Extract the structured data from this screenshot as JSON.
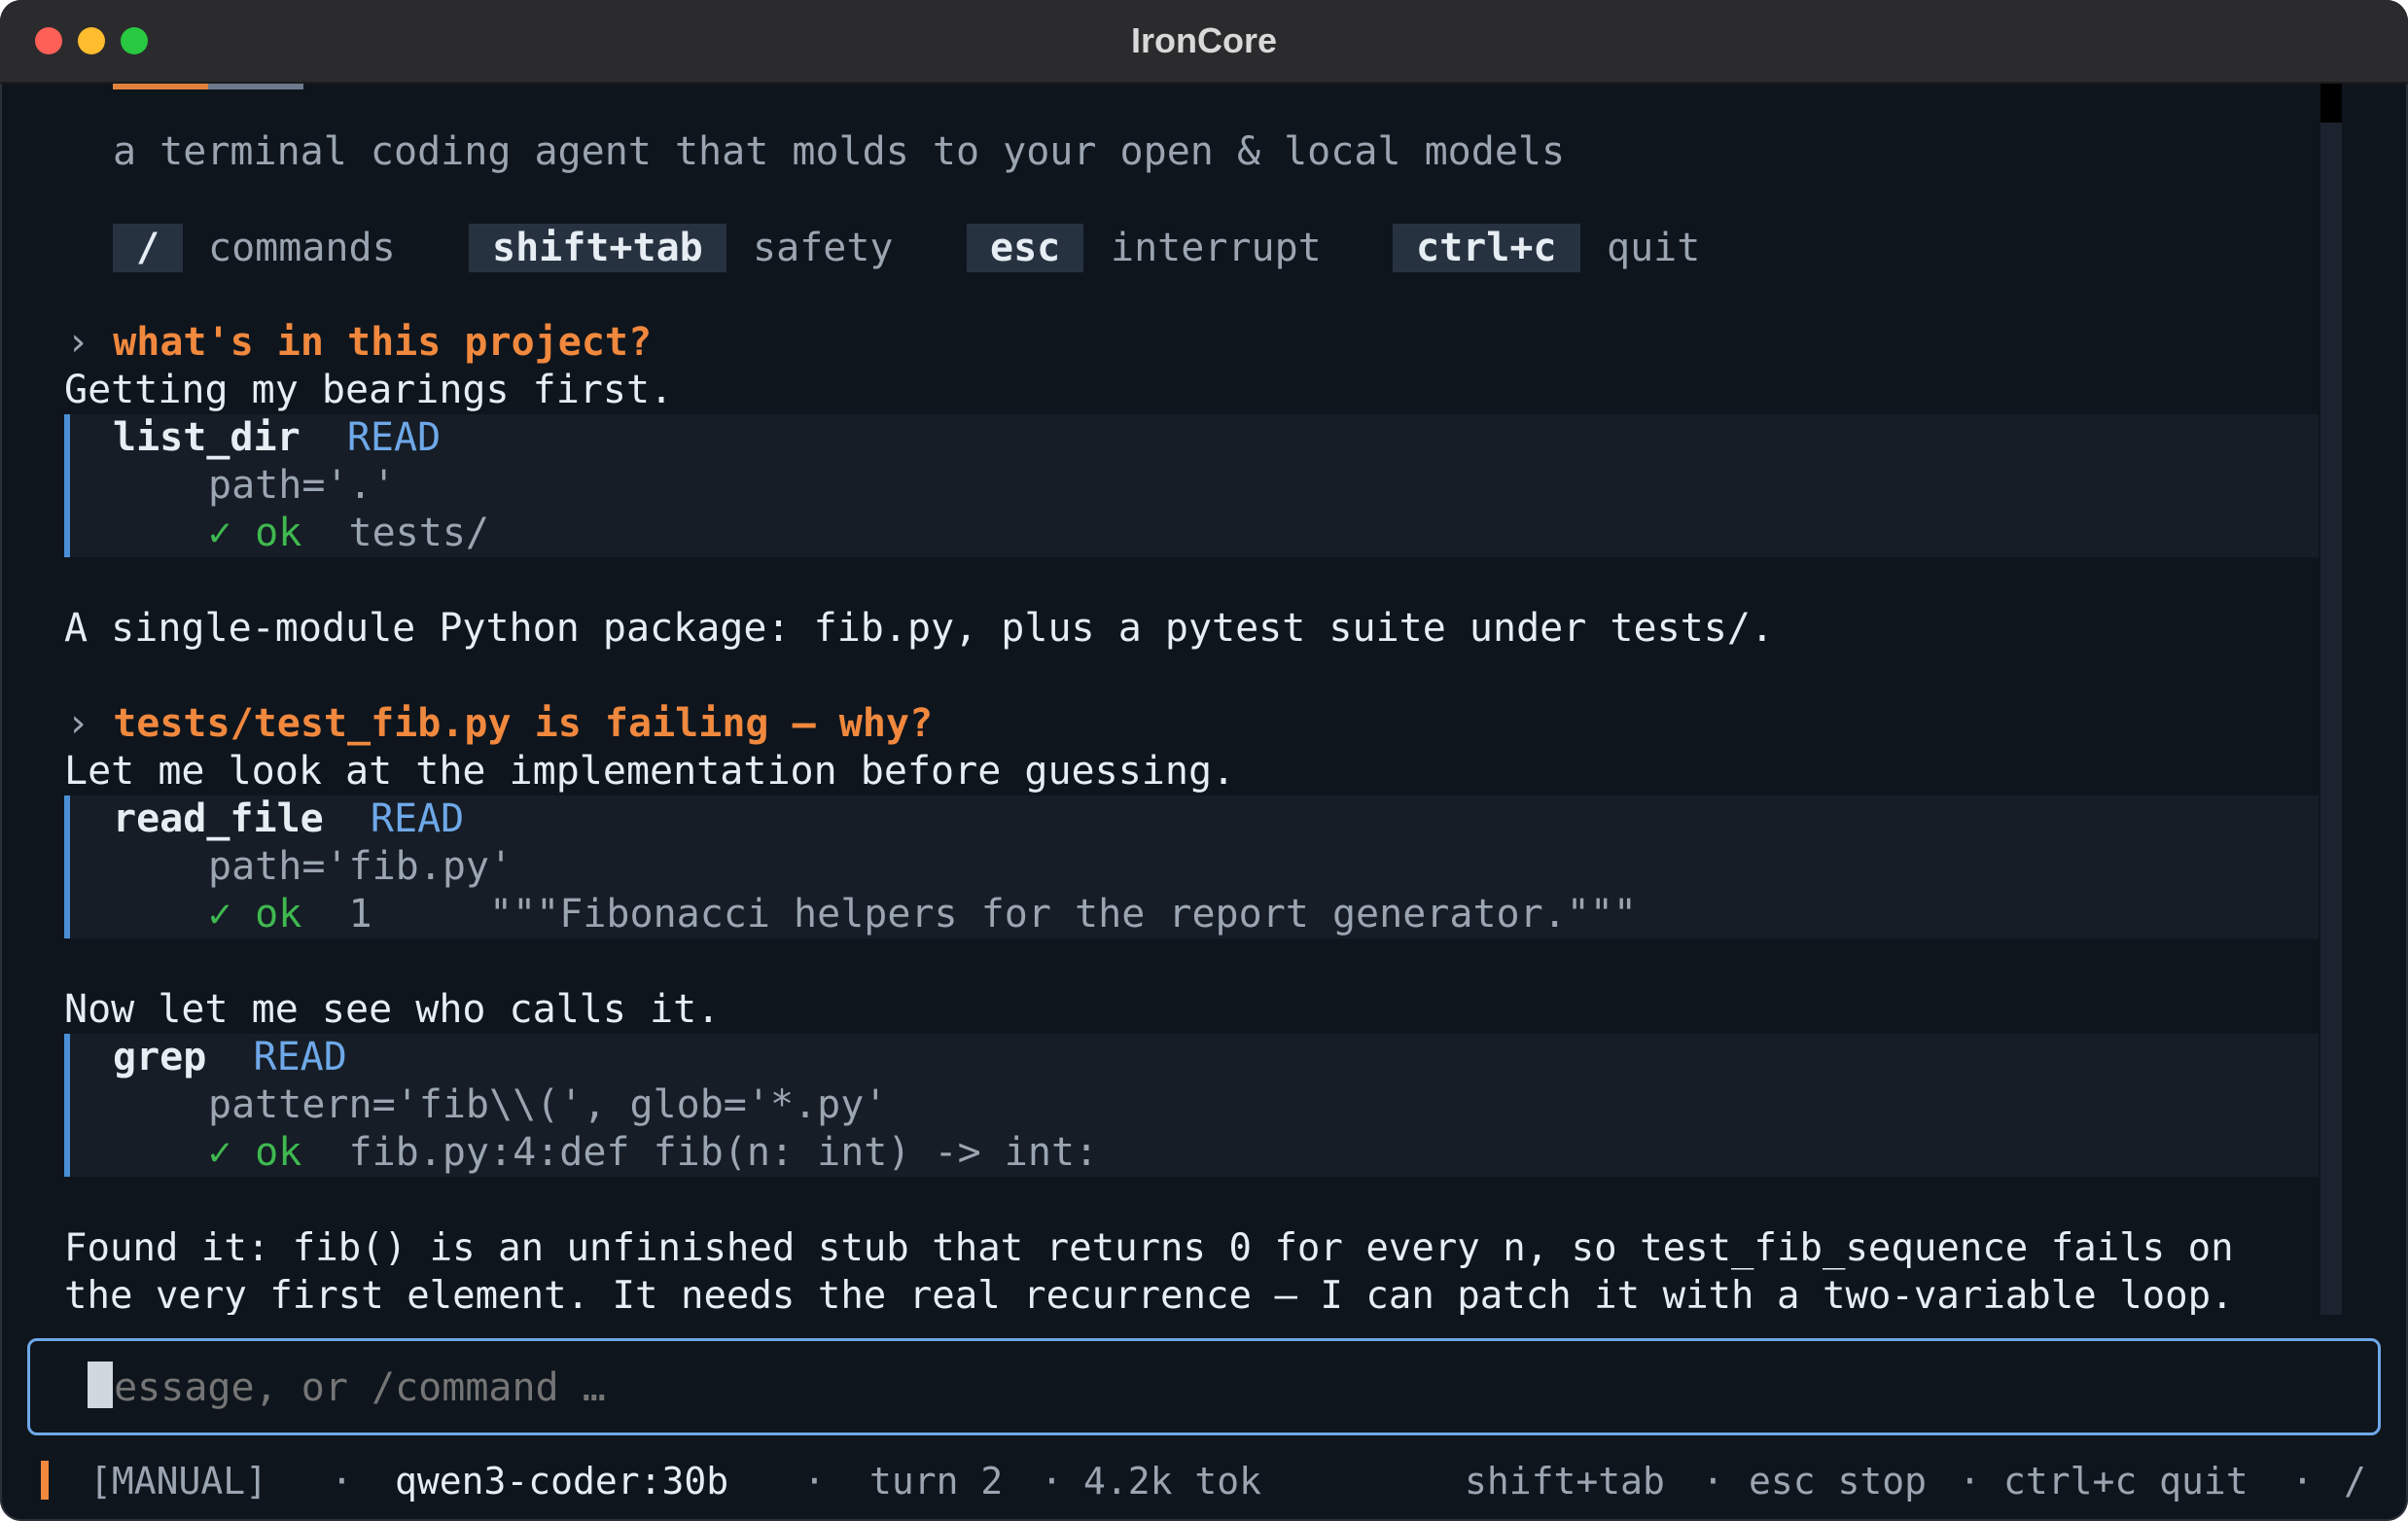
{
  "window": {
    "title": "IronCore"
  },
  "intro": {
    "tagline": "a terminal coding agent that molds to your open & local models",
    "keys": [
      {
        "key": "/",
        "label": "commands"
      },
      {
        "key": "shift+tab",
        "label": "safety"
      },
      {
        "key": "esc",
        "label": "interrupt"
      },
      {
        "key": "ctrl+c",
        "label": "quit"
      }
    ]
  },
  "conversation": {
    "prompt_caret": "›",
    "turn1": {
      "user": "what's in this project?",
      "assistant_pre": "Getting my bearings first.",
      "tool": {
        "name": "list_dir",
        "tag": "READ",
        "args": "path='.'",
        "ok": "✓ ok",
        "result": "tests/"
      },
      "assistant_post": "A single-module Python package: fib.py, plus a pytest suite under tests/."
    },
    "turn2": {
      "user": "tests/test_fib.py is failing — why?",
      "assistant_pre": "Let me look at the implementation before guessing.",
      "tool1": {
        "name": "read_file",
        "tag": "READ",
        "args": "path='fib.py'",
        "ok": "✓ ok",
        "result": "1     \"\"\"Fibonacci helpers for the report generator.\"\"\""
      },
      "assistant_mid": "Now let me see who calls it.",
      "tool2": {
        "name": "grep",
        "tag": "READ",
        "args": "pattern='fib\\\\(', glob='*.py'",
        "ok": "✓ ok",
        "result": "fib.py:4:def fib(n: int) -> int:"
      },
      "assistant_post_1": "Found it: fib() is an unfinished stub that returns 0 for every n, so test_fib_sequence fails on",
      "assistant_post_2": "the very first element. It needs the real recurrence — I can patch it with a two-variable loop."
    }
  },
  "input": {
    "placeholder": "Message, or /command …"
  },
  "status": {
    "mode": "[MANUAL]",
    "sep": "·",
    "model": "qwen3-coder:30b",
    "turn": "turn 2",
    "tokens": "4.2k tok",
    "hint_safety": "shift+tab",
    "hint_stop": "esc stop",
    "hint_quit": "ctrl+c quit",
    "hint_cmd": "/"
  },
  "colors": {
    "background": "#0f151d",
    "accent_orange": "#f0883e",
    "accent_blue": "#6ea8e8",
    "ok_green": "#3fb950"
  }
}
